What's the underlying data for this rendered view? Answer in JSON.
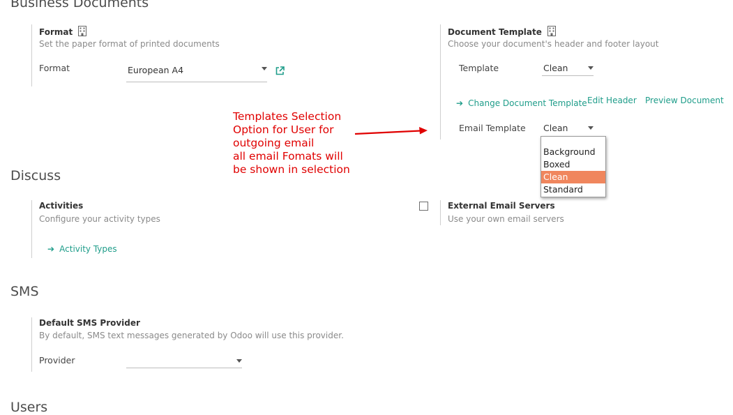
{
  "sections": {
    "business_documents": "Business Documents",
    "discuss": "Discuss",
    "sms": "SMS",
    "users": "Users"
  },
  "format": {
    "title": "Format",
    "description": "Set the paper format of printed documents",
    "label": "Format",
    "value": "European A4"
  },
  "document_template": {
    "title": "Document Template",
    "description": "Choose your document's header and footer layout",
    "template_label": "Template",
    "template_value": "Clean",
    "change_link": "Change Document Template",
    "edit_header": "Edit Header",
    "preview": "Preview Document",
    "email_label": "Email Template",
    "email_value": "Clean",
    "options": [
      "Background",
      "Boxed",
      "Clean",
      "Standard"
    ],
    "selected_option": "Clean"
  },
  "annotation": {
    "line1": "Templates Selection",
    "line2": "Option for User for",
    "line3": "outgoing email",
    "line4": "all email Fomats will",
    "line5": "be shown in selection",
    "color": "#e00000"
  },
  "activities": {
    "title": "Activities",
    "description": "Configure your activity types",
    "link": "Activity Types"
  },
  "external_email": {
    "title": "External Email Servers",
    "description": "Use your own email servers",
    "checked": false
  },
  "sms_provider": {
    "title": "Default SMS Provider",
    "description": "By default, SMS text messages generated by Odoo will use this provider.",
    "label": "Provider",
    "value": ""
  },
  "colors": {
    "link": "#1f9d8a",
    "highlight": "#f0865d",
    "annotation": "#e00000"
  }
}
